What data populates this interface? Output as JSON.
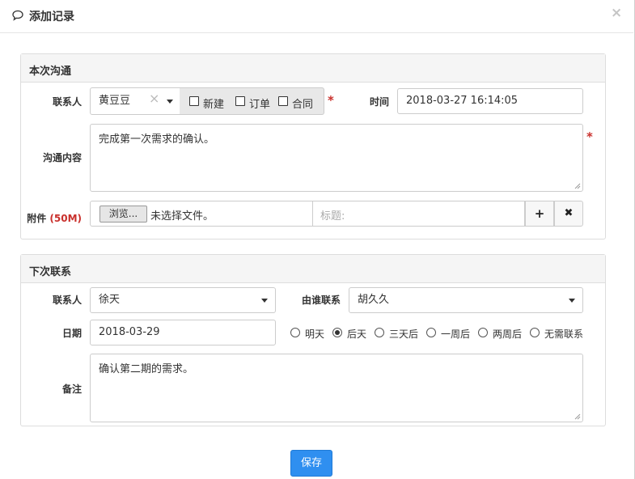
{
  "dialog": {
    "title": "添加记录",
    "close_glyph": "×",
    "title_icon": "comment-icon"
  },
  "section_current": {
    "heading": "本次沟通",
    "contact_label": "联系人",
    "contact_value": "黄豆豆",
    "contact_clear": "×",
    "checkboxes": [
      {
        "label": "新建",
        "checked": false
      },
      {
        "label": "订单",
        "checked": false
      },
      {
        "label": "合同",
        "checked": false
      }
    ],
    "required_mark": "*",
    "time_label": "时间",
    "time_value": "2018-03-27 16:14:05",
    "content_label": "沟通内容",
    "content_value": "完成第一次需求的确认。",
    "attachment_label": "附件",
    "attachment_limit": "(50M)",
    "browse_label": "浏览...",
    "no_file_text": "未选择文件。",
    "title_placeholder": "标题:",
    "add_glyph": "+",
    "remove_glyph": "✖"
  },
  "section_next": {
    "heading": "下次联系",
    "contact_label": "联系人",
    "contact_value": "徐天",
    "by_label": "由谁联系",
    "by_value": "胡久久",
    "date_label": "日期",
    "date_value": "2018-03-29",
    "radios": [
      {
        "label": "明天",
        "checked": false
      },
      {
        "label": "后天",
        "checked": true
      },
      {
        "label": "三天后",
        "checked": false
      },
      {
        "label": "一周后",
        "checked": false
      },
      {
        "label": "两周后",
        "checked": false
      },
      {
        "label": "无需联系",
        "checked": false
      }
    ],
    "note_label": "备注",
    "note_value": "确认第二期的需求。"
  },
  "footer": {
    "save_label": "保存"
  },
  "colors": {
    "primary": "#2f8ff0",
    "required": "#c9302c"
  }
}
